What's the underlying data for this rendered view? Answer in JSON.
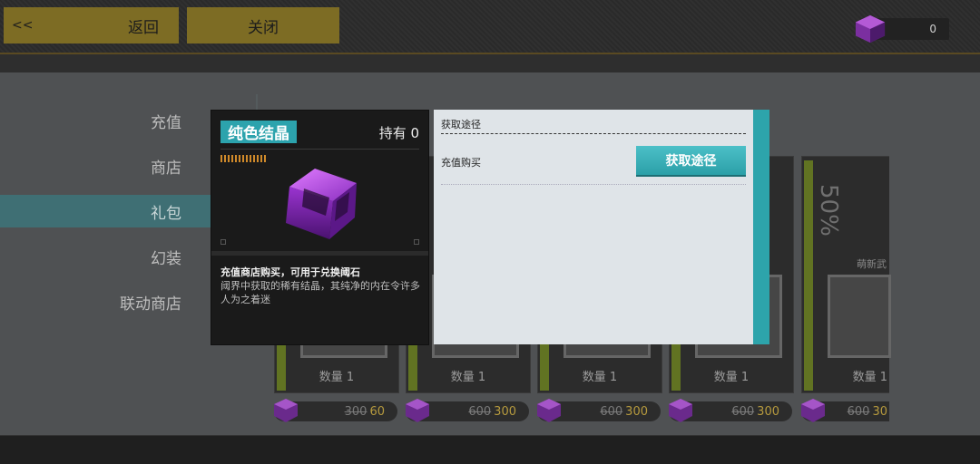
{
  "header": {
    "back_arrows": "<<",
    "back_label": "返回",
    "close_label": "关闭",
    "currency_amount": "0"
  },
  "sidebar": {
    "items": [
      {
        "label": "充值",
        "active": false
      },
      {
        "label": "商店",
        "active": false
      },
      {
        "label": "礼包",
        "active": true
      },
      {
        "label": "幻装",
        "active": false
      },
      {
        "label": "联动商店",
        "active": false
      }
    ]
  },
  "shop": {
    "cards": [
      {
        "quantity": "数量 1",
        "price_old": "300",
        "price_new": "60"
      },
      {
        "quantity": "数量 1",
        "price_old": "600",
        "price_new": "300"
      },
      {
        "quantity": "数量 1",
        "price_old": "600",
        "price_new": "300"
      },
      {
        "quantity": "数量 1",
        "price_old": "600",
        "price_new": "300"
      },
      {
        "quantity": "数量 1",
        "price_old": "600",
        "price_new": "30",
        "discount": "50%",
        "tag": "萌新武"
      }
    ]
  },
  "item_detail": {
    "name": "纯色结晶",
    "hold": "持有 0",
    "desc_title": "充值商店购买，可用于兑换阈石",
    "desc_body": "阈界中获取的稀有结晶，其纯净的内在令许多人为之着迷"
  },
  "acquisition": {
    "heading": "获取途径",
    "row_label": "充值购买",
    "button_label": "获取途径"
  },
  "colors": {
    "accent": "#2ca3ad",
    "gold_button": "#7d6c24",
    "price": "#b69a3e",
    "stripe": "#617322"
  }
}
